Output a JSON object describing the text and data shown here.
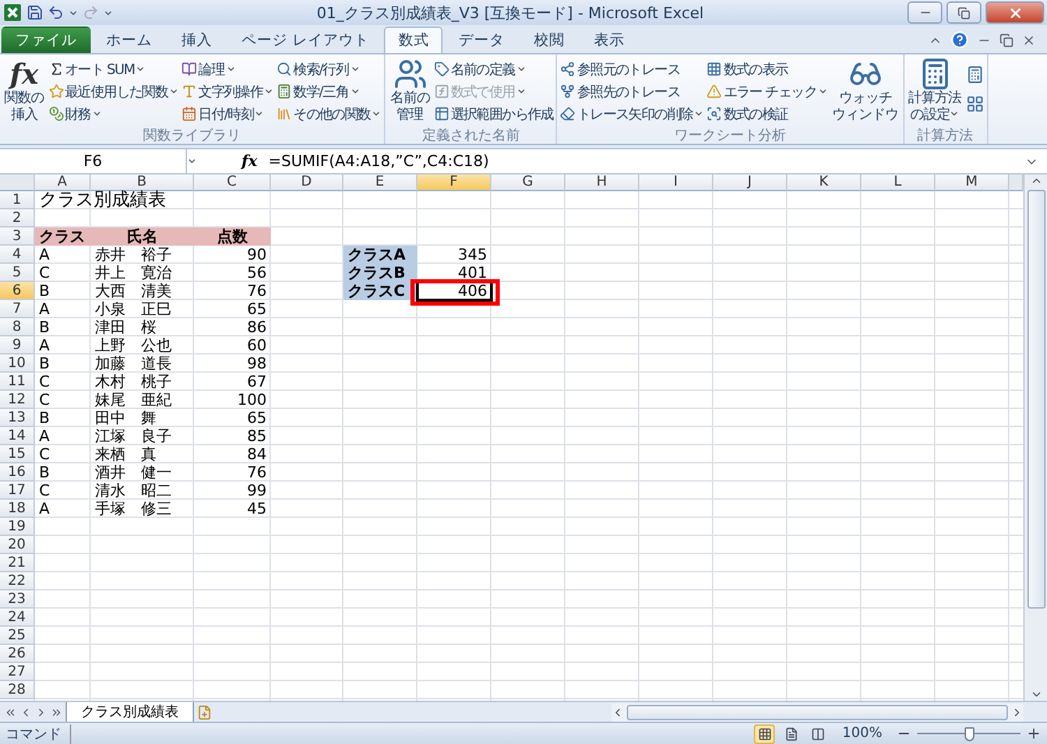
{
  "title_bar": {
    "title": "01_クラス別成績表_V3 [互換モード] - Microsoft Excel"
  },
  "tabs": [
    {
      "label": "ファイル",
      "kind": "file",
      "selected": false
    },
    {
      "label": "ホーム",
      "kind": "tab",
      "selected": false
    },
    {
      "label": "挿入",
      "kind": "tab",
      "selected": false
    },
    {
      "label": "ページ レイアウト",
      "kind": "tab",
      "selected": false
    },
    {
      "label": "数式",
      "kind": "tab",
      "selected": true
    },
    {
      "label": "データ",
      "kind": "tab",
      "selected": false
    },
    {
      "label": "校閲",
      "kind": "tab",
      "selected": false
    },
    {
      "label": "表示",
      "kind": "tab",
      "selected": false
    }
  ],
  "ribbon": [
    {
      "label": "関数ライブラリ",
      "columns": [
        {
          "kind": "large",
          "icon_text": "fx",
          "lines": [
            "関数の",
            "挿入"
          ],
          "dropdown": false
        },
        {
          "kind": "stack",
          "items": [
            {
              "label": "オート SUM",
              "dropdown": true,
              "disabled": false
            },
            {
              "label": "最近使用した関数",
              "dropdown": true,
              "disabled": false
            },
            {
              "label": "財務",
              "dropdown": true,
              "disabled": false
            }
          ]
        },
        {
          "kind": "stack",
          "items": [
            {
              "label": "論理",
              "dropdown": true,
              "disabled": false
            },
            {
              "label": "文字列操作",
              "dropdown": true,
              "disabled": false
            },
            {
              "label": "日付/時刻",
              "dropdown": true,
              "disabled": false
            }
          ]
        },
        {
          "kind": "stack",
          "items": [
            {
              "label": "検索/行列",
              "dropdown": true,
              "disabled": false
            },
            {
              "label": "数学/三角",
              "dropdown": true,
              "disabled": false
            },
            {
              "label": "その他の関数",
              "dropdown": true,
              "disabled": false
            }
          ]
        }
      ]
    },
    {
      "label": "定義された名前",
      "columns": [
        {
          "kind": "large",
          "lines": [
            "名前の",
            "管理"
          ],
          "dropdown": false
        },
        {
          "kind": "stack",
          "items": [
            {
              "label": "名前の定義",
              "dropdown": true,
              "disabled": false
            },
            {
              "label": "数式で使用",
              "dropdown": true,
              "disabled": true
            },
            {
              "label": "選択範囲から作成",
              "dropdown": false,
              "disabled": false
            }
          ]
        }
      ]
    },
    {
      "label": "ワークシート分析",
      "columns": [
        {
          "kind": "stack",
          "items": [
            {
              "label": "参照元のトレース",
              "dropdown": false,
              "disabled": false
            },
            {
              "label": "参照先のトレース",
              "dropdown": false,
              "disabled": false
            },
            {
              "label": "トレース矢印の削除",
              "dropdown": true,
              "disabled": false
            }
          ]
        },
        {
          "kind": "stack",
          "items": [
            {
              "label": "数式の表示",
              "dropdown": false,
              "disabled": false
            },
            {
              "label": "エラー チェック",
              "dropdown": true,
              "disabled": false
            },
            {
              "label": "数式の検証",
              "dropdown": false,
              "disabled": false
            }
          ]
        },
        {
          "kind": "large",
          "lines": [
            "ウォッチ",
            "ウィンドウ"
          ],
          "dropdown": false
        }
      ]
    },
    {
      "label": "計算方法",
      "columns": [
        {
          "kind": "large",
          "lines": [
            "計算方法",
            "の設定"
          ],
          "dropdown": true
        },
        {
          "kind": "icons"
        }
      ]
    }
  ],
  "formula_bar": {
    "name_box": "F6",
    "icon_text": "fx",
    "formula": "=SUMIF(A4:A18,”C”,C4:C18)"
  },
  "columns": [
    {
      "label": "A",
      "selected": false
    },
    {
      "label": "B",
      "selected": false
    },
    {
      "label": "C",
      "selected": false
    },
    {
      "label": "D",
      "selected": false
    },
    {
      "label": "E",
      "selected": false
    },
    {
      "label": "F",
      "selected": true
    },
    {
      "label": "G",
      "selected": false
    },
    {
      "label": "H",
      "selected": false
    },
    {
      "label": "I",
      "selected": false
    },
    {
      "label": "J",
      "selected": false
    },
    {
      "label": "K",
      "selected": false
    },
    {
      "label": "L",
      "selected": false
    },
    {
      "label": "M",
      "selected": false
    }
  ],
  "rows": [
    {
      "number": "1",
      "kind": "title",
      "selected": false,
      "cells": {
        "A": "クラス別成績表"
      }
    },
    {
      "number": "2",
      "kind": "data",
      "selected": false,
      "cells": {}
    },
    {
      "number": "3",
      "kind": "header",
      "selected": false,
      "cells": {
        "A": "クラス",
        "B": "氏名",
        "C": "点数"
      }
    },
    {
      "number": "4",
      "kind": "data",
      "selected": false,
      "cells": {
        "A": "A",
        "B": "赤井　裕子",
        "C": "90",
        "E": "クラスA",
        "F": "345"
      }
    },
    {
      "number": "5",
      "kind": "data",
      "selected": false,
      "cells": {
        "A": "C",
        "B": "井上　寛治",
        "C": "56",
        "E": "クラスB",
        "F": "401"
      }
    },
    {
      "number": "6",
      "kind": "data",
      "selected": true,
      "annotated": true,
      "cells": {
        "A": "B",
        "B": "大西　清美",
        "C": "76",
        "E": "クラスC",
        "F": "406"
      }
    },
    {
      "number": "7",
      "kind": "data",
      "selected": false,
      "cells": {
        "A": "A",
        "B": "小泉　正巳",
        "C": "65"
      }
    },
    {
      "number": "8",
      "kind": "data",
      "selected": false,
      "cells": {
        "A": "B",
        "B": "津田　桜",
        "C": "86"
      }
    },
    {
      "number": "9",
      "kind": "data",
      "selected": false,
      "cells": {
        "A": "A",
        "B": "上野　公也",
        "C": "60"
      }
    },
    {
      "number": "10",
      "kind": "data",
      "selected": false,
      "cells": {
        "A": "B",
        "B": "加藤　道長",
        "C": "98"
      }
    },
    {
      "number": "11",
      "kind": "data",
      "selected": false,
      "cells": {
        "A": "C",
        "B": "木村　桃子",
        "C": "67"
      }
    },
    {
      "number": "12",
      "kind": "data",
      "selected": false,
      "cells": {
        "A": "C",
        "B": "妹尾　亜紀",
        "C": "100"
      }
    },
    {
      "number": "13",
      "kind": "data",
      "selected": false,
      "cells": {
        "A": "B",
        "B": "田中　舞",
        "C": "65"
      }
    },
    {
      "number": "14",
      "kind": "data",
      "selected": false,
      "cells": {
        "A": "A",
        "B": "江塚　良子",
        "C": "85"
      }
    },
    {
      "number": "15",
      "kind": "data",
      "selected": false,
      "cells": {
        "A": "C",
        "B": "来栖　真",
        "C": "84"
      }
    },
    {
      "number": "16",
      "kind": "data",
      "selected": false,
      "cells": {
        "A": "B",
        "B": "酒井　健一",
        "C": "76"
      }
    },
    {
      "number": "17",
      "kind": "data",
      "selected": false,
      "cells": {
        "A": "C",
        "B": "清水　昭二",
        "C": "99"
      }
    },
    {
      "number": "18",
      "kind": "data",
      "selected": false,
      "cells": {
        "A": "A",
        "B": "手塚　修三",
        "C": "45"
      }
    },
    {
      "number": "19",
      "kind": "data",
      "selected": false,
      "cells": {}
    },
    {
      "number": "20",
      "kind": "data",
      "selected": false,
      "cells": {}
    },
    {
      "number": "21",
      "kind": "data",
      "selected": false,
      "cells": {}
    },
    {
      "number": "22",
      "kind": "data",
      "selected": false,
      "cells": {}
    },
    {
      "number": "23",
      "kind": "data",
      "selected": false,
      "cells": {}
    },
    {
      "number": "24",
      "kind": "data",
      "selected": false,
      "cells": {}
    },
    {
      "number": "25",
      "kind": "data",
      "selected": false,
      "cells": {}
    },
    {
      "number": "26",
      "kind": "data",
      "selected": false,
      "cells": {}
    },
    {
      "number": "27",
      "kind": "data",
      "selected": false,
      "cells": {}
    },
    {
      "number": "28",
      "kind": "data",
      "selected": false,
      "cells": {}
    }
  ],
  "sheet_tabs": [
    {
      "label": "クラス別成績表",
      "selected": true
    }
  ],
  "status_bar": {
    "mode": "コマンド",
    "views": [
      {
        "kind": "normal",
        "selected": true
      },
      {
        "kind": "layout",
        "selected": false
      },
      {
        "kind": "pagebreak",
        "selected": false
      }
    ],
    "zoom": "100%",
    "zoom_slider": {
      "level": 0.5
    }
  }
}
